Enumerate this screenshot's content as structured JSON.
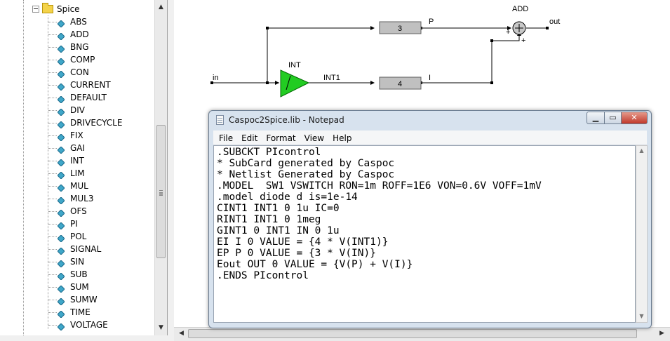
{
  "tree": {
    "root_label": "Spice",
    "items": [
      "ABS",
      "ADD",
      "BNG",
      "COMP",
      "CON",
      "CURRENT",
      "DEFAULT",
      "DIV",
      "DRIVECYCLE",
      "FIX",
      "GAI",
      "INT",
      "LIM",
      "MUL",
      "MUL3",
      "OFS",
      "PI",
      "POL",
      "SIGNAL",
      "SIN",
      "SUB",
      "SUM",
      "SUMW",
      "TIME",
      "VOLTAGE"
    ]
  },
  "diagram": {
    "input_label": "in",
    "int_label": "INT",
    "int_out_label": "INT1",
    "gain_p_value": "3",
    "gain_i_value": "4",
    "p_label": "P",
    "i_label": "I",
    "add_label": "ADD",
    "output_label": "out",
    "plus1": "+",
    "plus2": "+",
    "block_fill": "#c0c0c0",
    "int_fill": "#22cc22"
  },
  "notepad": {
    "title": "Caspoc2Spice.lib - Notepad",
    "menu": [
      "File",
      "Edit",
      "Format",
      "View",
      "Help"
    ],
    "lines": [
      ".SUBCKT PIcontrol",
      "* SubCard generated by Caspoc",
      "* Netlist Generated by Caspoc",
      ".MODEL  SW1 VSWITCH RON=1m ROFF=1E6 VON=0.6V VOFF=1mV",
      ".model diode d is=1e-14",
      "CINT1 INT1 0 1u IC=0",
      "RINT1 INT1 0 1meg",
      "GINT1 0 INT1 IN 0 1u",
      "EI I 0 VALUE = {4 * V(INT1)}",
      "EP P 0 VALUE = {3 * V(IN)}",
      "Eout OUT 0 VALUE = {V(P) + V(I)}",
      ".ENDS PIcontrol"
    ]
  }
}
